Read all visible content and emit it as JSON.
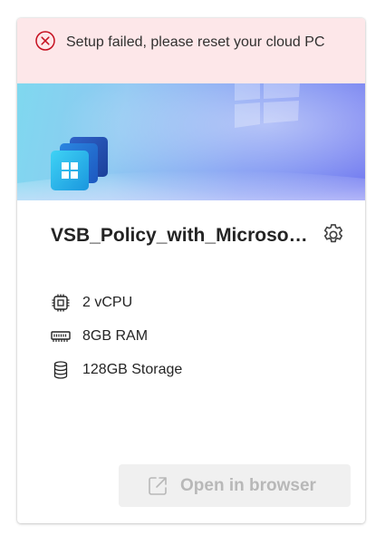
{
  "alert": {
    "icon": "error-circle-icon",
    "message": "Setup failed, please reset your cloud PC",
    "color": "#c50f1f",
    "background": "#fde7e9"
  },
  "banner": {
    "icon": "cloud-pc-windows-icon"
  },
  "pc": {
    "name": "VSB_Policy_with_Microsoft_Hosted_Network",
    "settings_icon": "gear-icon"
  },
  "specs": [
    {
      "icon": "cpu-icon",
      "label": "2 vCPU"
    },
    {
      "icon": "ram-icon",
      "label": "8GB RAM"
    },
    {
      "icon": "storage-icon",
      "label": "128GB Storage"
    }
  ],
  "actions": {
    "open_in_browser": {
      "icon": "open-external-icon",
      "label": "Open in browser",
      "disabled": true
    }
  }
}
